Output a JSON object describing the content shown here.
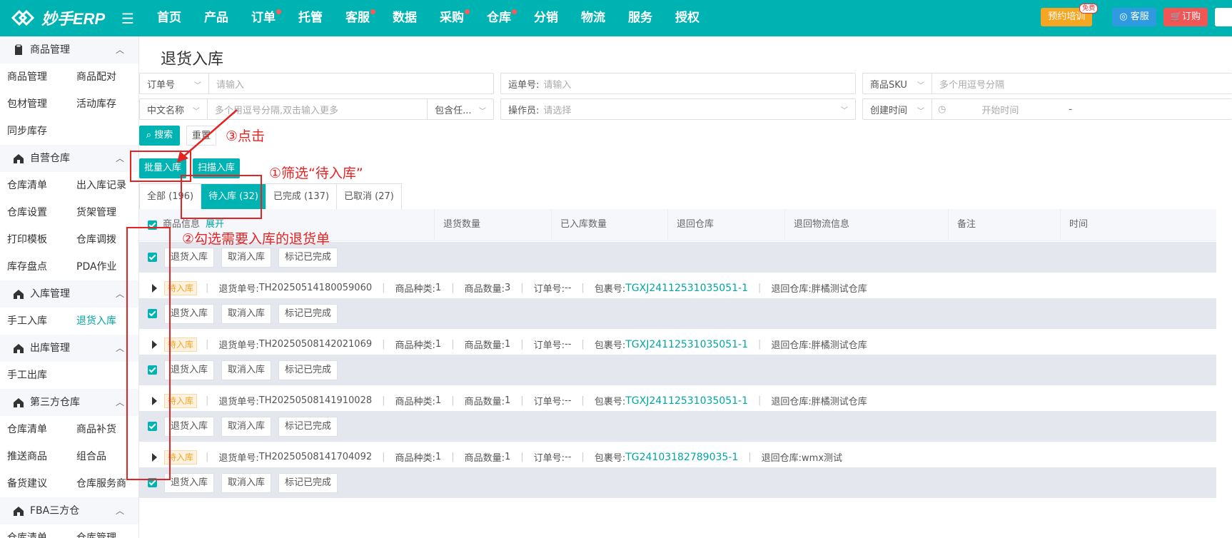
{
  "header": {
    "logo_text": "妙手ERP",
    "nav": [
      {
        "label": "首页",
        "dot": false
      },
      {
        "label": "产品",
        "dot": false
      },
      {
        "label": "订单",
        "dot": true
      },
      {
        "label": "托管",
        "dot": false
      },
      {
        "label": "客服",
        "dot": true
      },
      {
        "label": "数据",
        "dot": false
      },
      {
        "label": "采购",
        "dot": true
      },
      {
        "label": "仓库",
        "dot": true
      },
      {
        "label": "分销",
        "dot": false
      },
      {
        "label": "物流",
        "dot": false
      },
      {
        "label": "服务",
        "dot": false
      },
      {
        "label": "授权",
        "dot": false
      }
    ],
    "training_label": "预约培训",
    "free_badge": "免费",
    "service_label": "客服",
    "order_label": "订购"
  },
  "sidebar": {
    "groups": [
      {
        "title": "商品管理",
        "items": [
          [
            "商品管理",
            "商品配对"
          ],
          [
            "包材管理",
            "活动库存"
          ],
          [
            "同步库存",
            ""
          ]
        ]
      },
      {
        "title": "自营仓库",
        "items": [
          [
            "仓库清单",
            "出入库记录"
          ],
          [
            "仓库设置",
            "货架管理"
          ],
          [
            "打印模板",
            "仓库调拨"
          ],
          [
            "库存盘点",
            "PDA作业"
          ]
        ]
      },
      {
        "title": "入库管理",
        "items": [
          [
            "手工入库",
            "退货入库"
          ]
        ]
      },
      {
        "title": "出库管理",
        "items": [
          [
            "手工出库",
            ""
          ]
        ]
      },
      {
        "title": "第三方仓库",
        "items": [
          [
            "仓库清单",
            "商品补货"
          ],
          [
            "推送商品",
            "组合品"
          ],
          [
            "备货建议",
            "仓库服务商"
          ]
        ]
      },
      {
        "title": "FBA三方仓",
        "items": [
          [
            "仓库清单",
            "仓库管理"
          ]
        ]
      }
    ],
    "active_item": "退货入库"
  },
  "page": {
    "title": "退货入库",
    "filters": {
      "order_no_select": "订单号",
      "order_no_placeholder": "请输入",
      "waybill_label": "运单号:",
      "waybill_placeholder": "请输入",
      "sku_select": "商品SKU",
      "sku_placeholder": "多个用逗号分隔",
      "cn_name_select": "中文名称",
      "cn_name_placeholder": "多个用逗号分隔,双击输入更多",
      "include_select": "包含任...",
      "operator_label": "操作员:",
      "operator_placeholder": "请选择",
      "time_select": "创建时间",
      "start_time_placeholder": "开始时间",
      "range_sep": "-"
    },
    "search_label": "搜索",
    "reset_label": "重置",
    "batch_in_label": "批量入库",
    "scan_in_label": "扫描入库",
    "tabs": [
      {
        "label": "全部 (196)",
        "active": false
      },
      {
        "label": "待入库 (32)",
        "active": true
      },
      {
        "label": "已完成 (137)",
        "active": false
      },
      {
        "label": "已取消 (27)",
        "active": false
      }
    ],
    "table": {
      "col_product": "商品信息",
      "col_expand": "展开",
      "col_return_qty": "退货数量",
      "col_in_qty": "已入库数量",
      "col_return_wh": "退回仓库",
      "col_logistics": "退回物流信息",
      "col_remark": "备注",
      "col_time": "时间"
    },
    "row_actions": {
      "in": "退货入库",
      "cancel": "取消入库",
      "done": "标记已完成"
    },
    "rows": [
      {
        "status": "待入库",
        "return_no_label": "退货单号:",
        "return_no": "TH20250514180059060",
        "kind_label": "商品种类:",
        "kinds": "1",
        "qty_label": "商品数量:",
        "qty": "3",
        "order_label": "订单号:",
        "order": "--",
        "pkg_label": "包裹号:",
        "pkg": "TGXJ24112531035051-1",
        "wh_label": "退回仓库:",
        "wh": "胖橘测试仓库"
      },
      {
        "status": "待入库",
        "return_no_label": "退货单号:",
        "return_no": "TH20250508142021069",
        "kind_label": "商品种类:",
        "kinds": "1",
        "qty_label": "商品数量:",
        "qty": "1",
        "order_label": "订单号:",
        "order": "--",
        "pkg_label": "包裹号:",
        "pkg": "TGXJ24112531035051-1",
        "wh_label": "退回仓库:",
        "wh": "胖橘测试仓库"
      },
      {
        "status": "待入库",
        "return_no_label": "退货单号:",
        "return_no": "TH20250508141910028",
        "kind_label": "商品种类:",
        "kinds": "1",
        "qty_label": "商品数量:",
        "qty": "1",
        "order_label": "订单号:",
        "order": "--",
        "pkg_label": "包裹号:",
        "pkg": "TGXJ24112531035051-1",
        "wh_label": "退回仓库:",
        "wh": "胖橘测试仓库"
      },
      {
        "status": "待入库",
        "return_no_label": "退货单号:",
        "return_no": "TH20250508141704092",
        "kind_label": "商品种类:",
        "kinds": "1",
        "qty_label": "商品数量:",
        "qty": "1",
        "order_label": "订单号:",
        "order": "--",
        "pkg_label": "包裹号:",
        "pkg": "TG24103182789035-1",
        "wh_label": "退回仓库:",
        "wh": "wmx测试"
      }
    ]
  },
  "annotations": {
    "step1": "①筛选“待入库”",
    "step2": "②勾选需要入库的退货单",
    "step3": "③点击"
  },
  "colors": {
    "primary": "#00b3b3",
    "annotation": "#e52323",
    "warning": "#f5a623"
  }
}
